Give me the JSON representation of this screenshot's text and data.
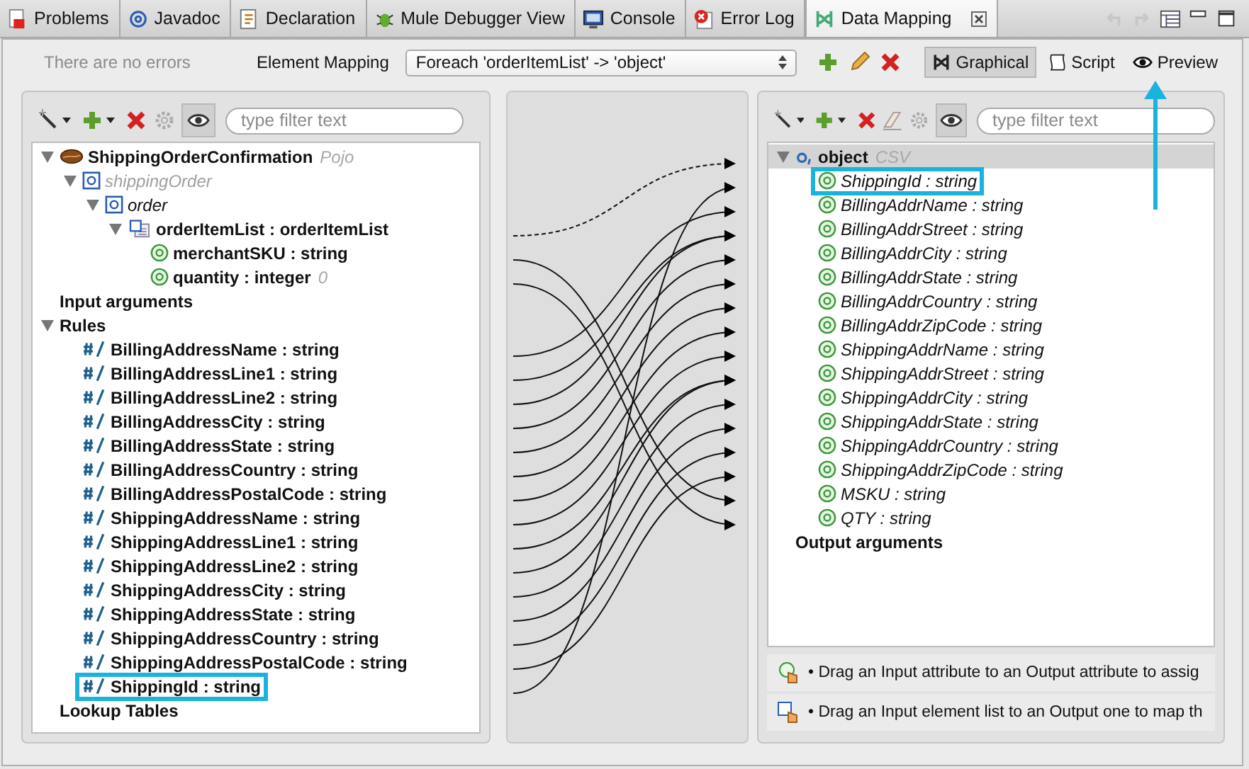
{
  "tabs": [
    {
      "label": "Problems",
      "kind": "problems",
      "selected": false
    },
    {
      "label": "Javadoc",
      "kind": "javadoc",
      "selected": false
    },
    {
      "label": "Declaration",
      "kind": "declaration",
      "selected": false
    },
    {
      "label": "Mule Debugger View",
      "kind": "debugger",
      "selected": false
    },
    {
      "label": "Console",
      "kind": "console",
      "selected": false
    },
    {
      "label": "Error Log",
      "kind": "errorlog",
      "selected": false
    },
    {
      "label": "Data Mapping",
      "kind": "datamapping",
      "selected": true
    }
  ],
  "toolbar": {
    "status": "There are no errors",
    "mapping_label": "Element Mapping",
    "mapping_value": "Foreach 'orderItemList' -> 'object'",
    "modes": [
      {
        "label": "Graphical",
        "kind": "graphical",
        "selected": true
      },
      {
        "label": "Script",
        "kind": "script",
        "selected": false
      },
      {
        "label": "Preview",
        "kind": "preview",
        "selected": false
      }
    ]
  },
  "input_panel": {
    "filter_placeholder": "type filter text",
    "tree": [
      {
        "label": "ShippingOrderConfirmation",
        "suffix": "Pojo",
        "kind": "bean",
        "expanded": true,
        "selected": false,
        "children": [
          {
            "label": "shippingOrder",
            "kind": "element",
            "dimmed": true,
            "expanded": true,
            "children": [
              {
                "label": "order",
                "kind": "element",
                "dimmed": false,
                "expanded": true,
                "children": [
                  {
                    "label": "orderItemList : orderItemList",
                    "kind": "elementlist",
                    "expanded": true,
                    "children": [
                      {
                        "label": "merchantSKU : string",
                        "kind": "attribute"
                      },
                      {
                        "label": "quantity : integer",
                        "suffix": "0",
                        "kind": "attribute"
                      }
                    ]
                  }
                ]
              }
            ]
          }
        ]
      },
      {
        "label": "Input arguments",
        "kind": "section"
      },
      {
        "label": "Rules",
        "kind": "section",
        "expanded": true,
        "children": [
          {
            "label": "BillingAddressName : string",
            "kind": "rule",
            "highlighted": false
          },
          {
            "label": "BillingAddressLine1 : string",
            "kind": "rule",
            "highlighted": false
          },
          {
            "label": "BillingAddressLine2 : string",
            "kind": "rule",
            "highlighted": false
          },
          {
            "label": "BillingAddressCity : string",
            "kind": "rule",
            "highlighted": false
          },
          {
            "label": "BillingAddressState : string",
            "kind": "rule",
            "highlighted": false
          },
          {
            "label": "BillingAddressCountry : string",
            "kind": "rule",
            "highlighted": false
          },
          {
            "label": "BillingAddressPostalCode : string",
            "kind": "rule",
            "highlighted": false
          },
          {
            "label": "ShippingAddressName : string",
            "kind": "rule",
            "highlighted": false
          },
          {
            "label": "ShippingAddressLine1 : string",
            "kind": "rule",
            "highlighted": false
          },
          {
            "label": "ShippingAddressLine2 : string",
            "kind": "rule",
            "highlighted": false
          },
          {
            "label": "ShippingAddressCity : string",
            "kind": "rule",
            "highlighted": false
          },
          {
            "label": "ShippingAddressState : string",
            "kind": "rule",
            "highlighted": false
          },
          {
            "label": "ShippingAddressCountry : string",
            "kind": "rule",
            "highlighted": false
          },
          {
            "label": "ShippingAddressPostalCode : string",
            "kind": "rule",
            "highlighted": false
          },
          {
            "label": "ShippingId : string",
            "kind": "rule",
            "highlighted": true
          }
        ]
      },
      {
        "label": "Lookup Tables",
        "kind": "section"
      }
    ]
  },
  "output_panel": {
    "filter_placeholder": "type filter text",
    "tree": [
      {
        "label": "object",
        "suffix": "CSV",
        "kind": "csvobject",
        "expanded": true,
        "selected": true,
        "children": [
          {
            "label": "ShippingId : string",
            "kind": "attribute",
            "highlighted": true
          },
          {
            "label": "BillingAddrName : string",
            "kind": "attribute",
            "highlighted": false
          },
          {
            "label": "BillingAddrStreet : string",
            "kind": "attribute",
            "highlighted": false
          },
          {
            "label": "BillingAddrCity : string",
            "kind": "attribute",
            "highlighted": false
          },
          {
            "label": "BillingAddrState : string",
            "kind": "attribute",
            "highlighted": false
          },
          {
            "label": "BillingAddrCountry : string",
            "kind": "attribute",
            "highlighted": false
          },
          {
            "label": "BillingAddrZipCode : string",
            "kind": "attribute",
            "highlighted": false
          },
          {
            "label": "ShippingAddrName : string",
            "kind": "attribute",
            "highlighted": false
          },
          {
            "label": "ShippingAddrStreet : string",
            "kind": "attribute",
            "highlighted": false
          },
          {
            "label": "ShippingAddrCity : string",
            "kind": "attribute",
            "highlighted": false
          },
          {
            "label": "ShippingAddrState : string",
            "kind": "attribute",
            "highlighted": false
          },
          {
            "label": "ShippingAddrCountry : string",
            "kind": "attribute",
            "highlighted": false
          },
          {
            "label": "ShippingAddrZipCode : string",
            "kind": "attribute",
            "highlighted": false
          },
          {
            "label": "MSKU : string",
            "kind": "attribute",
            "highlighted": false
          },
          {
            "label": "QTY : string",
            "kind": "attribute",
            "highlighted": false
          }
        ]
      },
      {
        "label": "Output arguments",
        "kind": "section"
      }
    ],
    "hints": [
      {
        "text": "• Drag an Input attribute to an Output attribute to assig",
        "kind": "attribute"
      },
      {
        "text": "• Drag an Input element list to an Output one to map th",
        "kind": "list"
      }
    ]
  }
}
